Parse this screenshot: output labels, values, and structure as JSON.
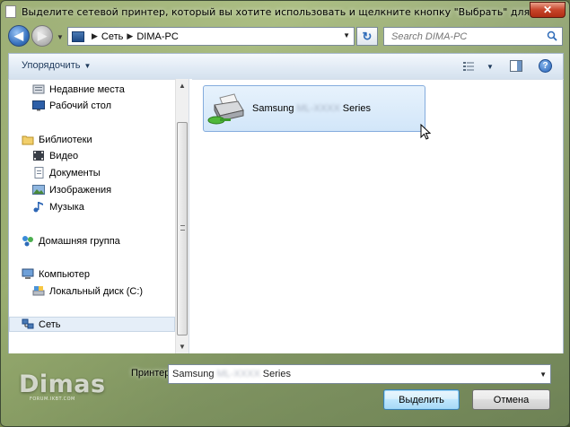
{
  "window": {
    "title": "Выделите сетевой принтер, который вы хотите использовать и щелкните кнопку \"Выбрать\" для подключения к...",
    "close_label": "✕"
  },
  "address": {
    "crumbs": [
      "Сеть",
      "DIMA-PC"
    ],
    "search_placeholder": "Search DIMA-PC"
  },
  "toolbar": {
    "organize_label": "Упорядочить"
  },
  "sidebar": {
    "items": [
      {
        "label": "Недавние места",
        "icon": "recent-places-icon"
      },
      {
        "label": "Рабочий стол",
        "icon": "desktop-icon"
      },
      {
        "label": "Библиотеки",
        "icon": "libraries-icon"
      },
      {
        "label": "Видео",
        "icon": "video-icon"
      },
      {
        "label": "Документы",
        "icon": "documents-icon"
      },
      {
        "label": "Изображения",
        "icon": "images-icon"
      },
      {
        "label": "Музыка",
        "icon": "music-icon"
      },
      {
        "label": "Домашняя группа",
        "icon": "homegroup-icon"
      },
      {
        "label": "Компьютер",
        "icon": "computer-icon"
      },
      {
        "label": "Локальный диск (C:)",
        "icon": "local-disk-icon"
      },
      {
        "label": "Сеть",
        "icon": "network-icon"
      }
    ],
    "selected": "Сеть"
  },
  "main": {
    "items": [
      {
        "name_prefix": "Samsung",
        "name_hidden": "ML-XXXX",
        "name_suffix": "Series",
        "icon": "network-printer-icon"
      }
    ]
  },
  "footer": {
    "logo_text": "Dimas",
    "logo_sub": "FORUM.IKBT.COM",
    "printer_label": "Принтер",
    "printer_value_prefix": "Samsung",
    "printer_value_hidden": "ML-XXXX",
    "printer_value_suffix": "Series",
    "select_button": "Выделить",
    "cancel_button": "Отмена"
  },
  "colors": {
    "selection_bg": "#d2e6f9",
    "selection_border": "#84acdd",
    "accent": "#2e6bb8"
  }
}
